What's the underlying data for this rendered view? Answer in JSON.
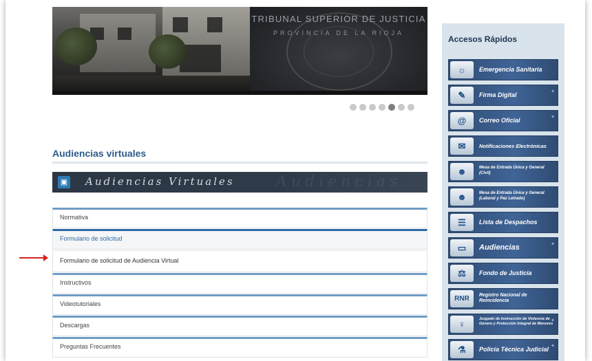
{
  "hero": {
    "line1": "TRIBUNAL SUPERIOR DE JUSTICIA",
    "line2": "PROVINCIA DE LA RIOJA",
    "slides": 7,
    "active_slide": 5
  },
  "section": {
    "title": "Audiencias virtuales",
    "banner_text": "Audiencias Virtuales"
  },
  "accordion": [
    {
      "label": "Normativa",
      "state": "closed"
    },
    {
      "label": "Formulario de solicitud",
      "state": "open"
    },
    {
      "label": "Formulario de solicitud de Audiencia Virtual",
      "state": "sub"
    },
    {
      "label": "Instructivos",
      "state": "closed"
    },
    {
      "label": "Videotutoriales",
      "state": "closed"
    },
    {
      "label": "Descargas",
      "state": "closed"
    },
    {
      "label": "Preguntas Frecuentes",
      "state": "closed"
    }
  ],
  "sidebar": {
    "title": "Accesos Rápidos",
    "items": [
      {
        "label": "Emergencia Sanitaria",
        "icon": "globe-icon"
      },
      {
        "label": "Firma Digital",
        "icon": "document-icon"
      },
      {
        "label": "Correo Oficial",
        "icon": "at-sign-icon"
      },
      {
        "label": "Notificaciones Electrónicas",
        "icon": "mail-hand-icon"
      },
      {
        "label": "Mesa de Entrada Única y General (Civil)",
        "icon": "people-icon"
      },
      {
        "label": "Mesa de Entrada Única y General (Laboral y Paz Letrado)",
        "icon": "people-icon"
      },
      {
        "label": "Lista de Despachos",
        "icon": "list-icon"
      },
      {
        "label": "Audiencias",
        "icon": "monitor-icon"
      },
      {
        "label": "Fondo de Justicia",
        "icon": "scales-icon"
      },
      {
        "label": "Registro Nacional de Reincidencia",
        "icon": "rnr-logo-icon"
      },
      {
        "label": "Juzgado de Instrucción de Violencia de Género y Protección Integral de Menores",
        "icon": "gender-icon"
      },
      {
        "label": "Policía Técnica Judicial",
        "icon": "microscope-icon"
      }
    ]
  },
  "colors": {
    "accent": "#2b6aa5",
    "sidebar_bg": "#d8e3ec",
    "quick_button": "#3f6496",
    "arrow": "#d62020"
  }
}
